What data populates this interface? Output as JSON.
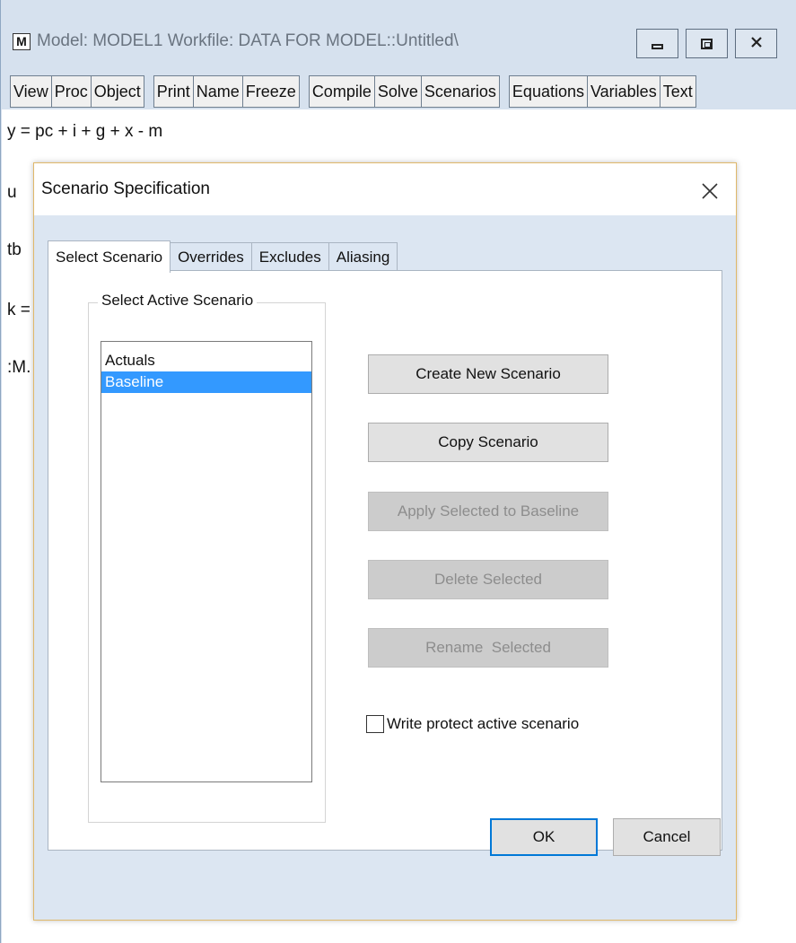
{
  "window": {
    "icon_letter": "M",
    "title": "Model: MODEL1   Workfile: DATA FOR MODEL::Untitled\\",
    "controls": {
      "minimize": "minimize",
      "maximize": "maximize",
      "close": "close"
    }
  },
  "toolbar": {
    "groups": [
      [
        "View",
        "Proc",
        "Object"
      ],
      [
        "Print",
        "Name",
        "Freeze"
      ],
      [
        "Compile",
        "Solve",
        "Scenarios"
      ],
      [
        "Equations",
        "Variables",
        "Text"
      ]
    ]
  },
  "model_text": {
    "lines": [
      "y = pc + i + g + x - m",
      "u",
      "tb",
      "k =",
      ":M."
    ]
  },
  "dialog": {
    "title": "Scenario Specification",
    "close_glyph": "✕",
    "tabs": [
      "Select Scenario",
      "Overrides",
      "Excludes",
      "Aliasing"
    ],
    "active_tab": "Select Scenario",
    "group_label": "Select Active Scenario",
    "scenarios": [
      "Actuals",
      "Baseline"
    ],
    "selected_scenario": "Baseline",
    "buttons": {
      "create": "Create New Scenario",
      "copy": "Copy Scenario",
      "apply": "Apply Selected to Baseline",
      "delete": "Delete Selected",
      "rename": "Rename  Selected"
    },
    "checkbox": {
      "label": "Write protect active scenario",
      "checked": false
    },
    "ok": "OK",
    "cancel": "Cancel"
  },
  "colors": {
    "selection": "#3399ff",
    "dialog_border": "#e0b86a",
    "default_button_border": "#0078d7",
    "chrome_background": "#d6e1ee"
  }
}
